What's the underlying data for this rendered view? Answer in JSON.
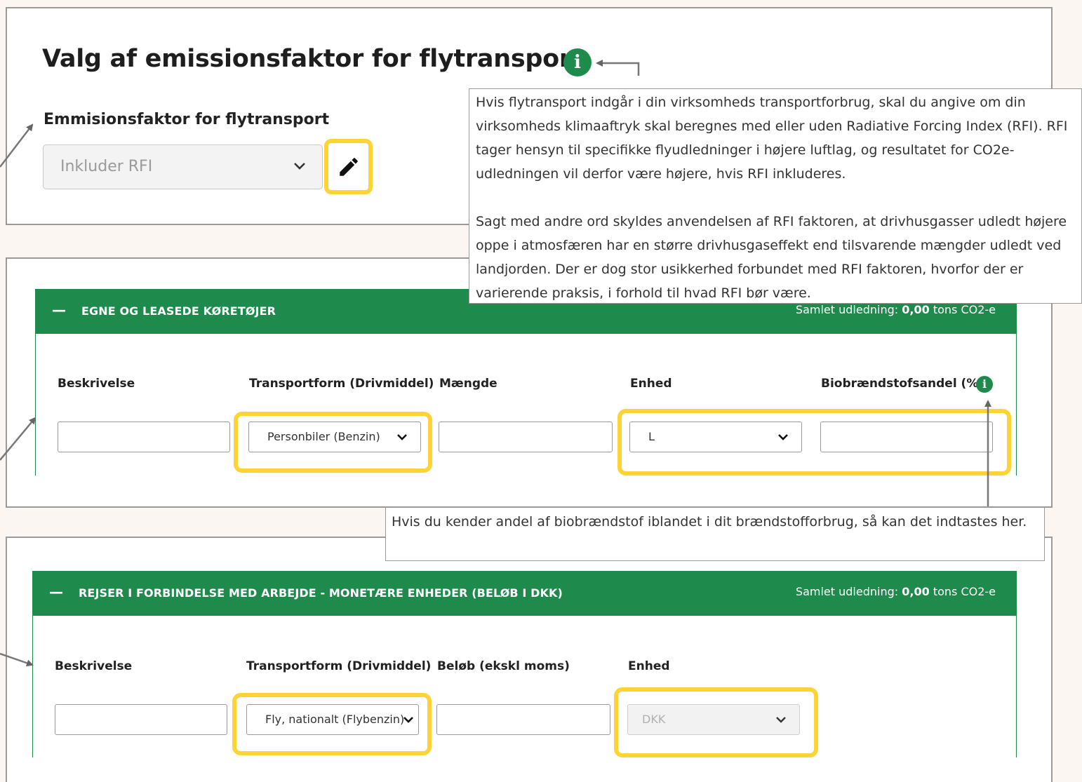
{
  "panel1": {
    "title": "Valg af emissionsfaktor for flytransport",
    "info_icon": "info-icon",
    "field_label": "Emmisionsfaktor for flytransport",
    "select_value": "Inkluder RFI",
    "edit_icon": "pencil-icon"
  },
  "tooltip_rfi": {
    "paragraph1": "Hvis flytransport indgår i din virksomheds transportforbrug, skal du angive om din virksomheds klimaaftryk skal beregnes med eller uden Radiative Forcing Index (RFI). RFI tager hensyn til specifikke flyudledninger i højere luftlag, og resultatet for CO2e-udledningen vil derfor være højere, hvis RFI inkluderes.",
    "paragraph2": "Sagt med andre ord skyldes anvendelsen af RFI faktoren, at drivhusgasser udledt højere oppe i atmosfæren har en større drivhusgaseffekt end tilsvarende mængder udledt ved landjorden. Der er dog stor usikkerhed forbundet med RFI faktoren, hvorfor der er varierende praksis, i forhold til hvad RFI bør være."
  },
  "section1": {
    "collapse_symbol": "—",
    "title": "EGNE OG LEASEDE KØRETØJER",
    "total_label": "Samlet udledning:",
    "total_value": "0,00",
    "total_unit": "tons CO2-e",
    "columns": {
      "description": "Beskrivelse",
      "transport": "Transportform (Drivmiddel)",
      "amount": "Mængde",
      "unit": "Enhed",
      "bio": "Biobrændstofsandel (%)"
    },
    "values": {
      "description": "",
      "transport": "Personbiler (Benzin)",
      "amount": "",
      "unit": "L",
      "bio": ""
    }
  },
  "tooltip_bio": {
    "text": "Hvis du kender andel af biobrændstof iblandet i dit brændstofforbrug, så kan det indtastes her."
  },
  "section2": {
    "collapse_symbol": "—",
    "title": "REJSER I FORBINDELSE MED ARBEJDE - MONETÆRE ENHEDER (BELØB I DKK)",
    "total_label": "Samlet udledning:",
    "total_value": "0,00",
    "total_unit": "tons CO2-e",
    "columns": {
      "description": "Beskrivelse",
      "transport": "Transportform (Drivmiddel)",
      "amount": "Beløb (ekskl moms)",
      "unit": "Enhed"
    },
    "values": {
      "description": "",
      "transport": "Fly, nationalt (Flybenzin)",
      "amount": "",
      "unit": "DKK"
    }
  },
  "colors": {
    "header_green": "#1e8a4c",
    "highlight_yellow": "#fdd335"
  }
}
